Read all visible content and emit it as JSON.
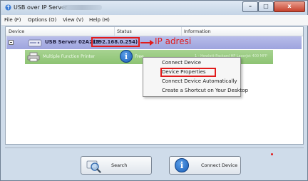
{
  "window": {
    "title": "USB over IP Server",
    "controls": {
      "minimize": "–",
      "maximize": "□",
      "close": "x"
    }
  },
  "menu": [
    "File (F)",
    "Options (O)",
    "View (V)",
    "Help (H)"
  ],
  "columns": [
    "Device",
    "Status",
    "Information"
  ],
  "server": {
    "name": "USB Server 02A213",
    "ip": "(192.168.0.254)",
    "annotation": "IP adresi"
  },
  "device": {
    "name": "Multiple Function Printer",
    "status": "Free",
    "info": "1 - Hewlett-Packard HP LaserJet 400 MFP"
  },
  "context_menu": [
    "Connect Device",
    "Device Properties",
    "Connect Device Automatically",
    "Create a Shortcut on Your Desktop"
  ],
  "buttons": {
    "search": "Search",
    "connect": "Connect Device"
  },
  "colors": {
    "annotation": "#e11b1b",
    "server_row": "#a8addf",
    "device_row": "#98ca7f"
  }
}
